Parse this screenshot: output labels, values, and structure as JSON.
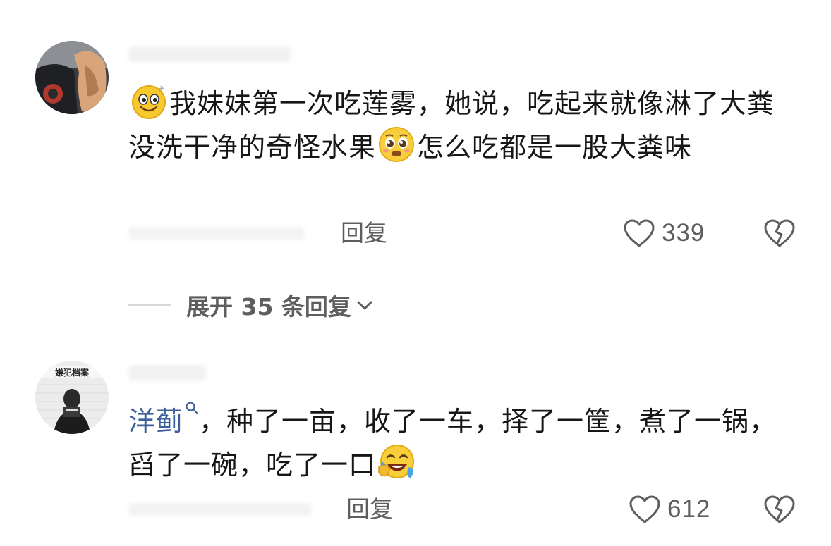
{
  "comments": [
    {
      "text_segments": [
        "我妹妹第一次吃莲雾，她说，吃起来就像淋了大粪没洗干净的奇怪水果",
        "怎么吃都是一股大粪味"
      ],
      "reply_label": "回复",
      "like_count": "339",
      "emojis": [
        "smile-emoji-icon",
        "pleading-emoji-icon"
      ]
    },
    {
      "mention": "洋蓟",
      "text_segments": [
        "，种了一亩，收了一车，择了一筐，煮了一锅，舀了一碗，吃了一口"
      ],
      "reply_label": "回复",
      "like_count": "612",
      "emojis": [
        "laughing-tears-emoji-icon"
      ]
    }
  ],
  "expand_replies": {
    "label": "展开 35 条回复"
  },
  "colors": {
    "text": "#161616",
    "secondary": "#5e5e5e",
    "mention": "#3d5f9c"
  }
}
